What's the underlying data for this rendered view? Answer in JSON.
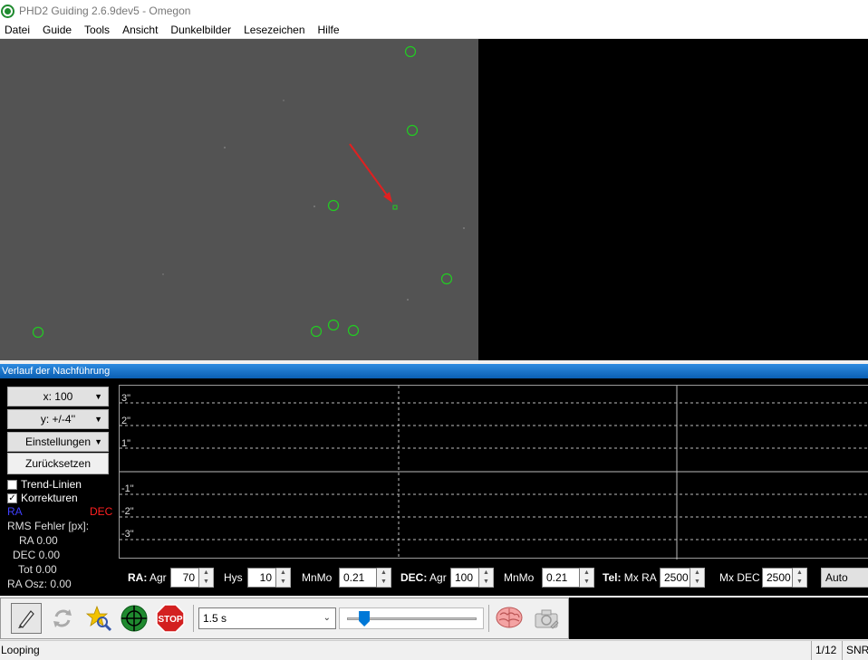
{
  "window": {
    "title": "PHD2 Guiding 2.6.9dev5 - Omegon"
  },
  "menu": [
    "Datei",
    "Guide",
    "Tools",
    "Ansicht",
    "Dunkelbilder",
    "Lesezeichen",
    "Hilfe"
  ],
  "graph": {
    "title": "Verlauf der Nachführung",
    "x_scale": "x: 100",
    "y_scale": "y: +/-4''",
    "settings": "Einstellungen",
    "reset": "Zurücksetzen",
    "trend_lines": "Trend-Linien",
    "trend_lines_checked": false,
    "corrections": "Korrekturen",
    "corrections_checked": true,
    "ra_legend": "RA",
    "dec_legend": "DEC",
    "ra_color": "#4040ff",
    "dec_color": "#ff2020",
    "rms_title": "RMS Fehler [px]:",
    "rms_ra": "RA 0.00",
    "rms_dec": "DEC 0.00",
    "rms_tot": "Tot 0.00",
    "ra_osc": "RA Osz: 0.00",
    "y_ticks": [
      "3\"",
      "2\"",
      "1\"",
      "-1\"",
      "-2\"",
      "-3\""
    ]
  },
  "params": {
    "ra_label": "RA:",
    "ra_agr_label": "Agr",
    "ra_agr": "70",
    "ra_hys_label": "Hys",
    "ra_hys": "10",
    "ra_mnmo_label": "MnMo",
    "ra_mnmo": "0.21",
    "dec_label": "DEC:",
    "dec_agr_label": "Agr",
    "dec_agr": "100",
    "dec_mnmo_label": "MnMo",
    "dec_mnmo": "0.21",
    "tel_label": "Tel:",
    "mx_ra_label": "Mx RA",
    "mx_ra": "2500",
    "mx_dec_label": "Mx DEC",
    "mx_dec": "2500",
    "mode": "Auto"
  },
  "toolbar": {
    "exposure": "1.5 s",
    "gamma_fraction": 0.1,
    "icons": [
      "gear-connect-icon",
      "loop-icon",
      "auto-select-star-icon",
      "guide-crosshair-icon",
      "stop-icon",
      "brain-icon",
      "camera-settings-icon"
    ]
  },
  "status": {
    "text": "Looping",
    "frame": "1/12",
    "snr": "SNR"
  },
  "stars": {
    "count_circles": 9
  }
}
